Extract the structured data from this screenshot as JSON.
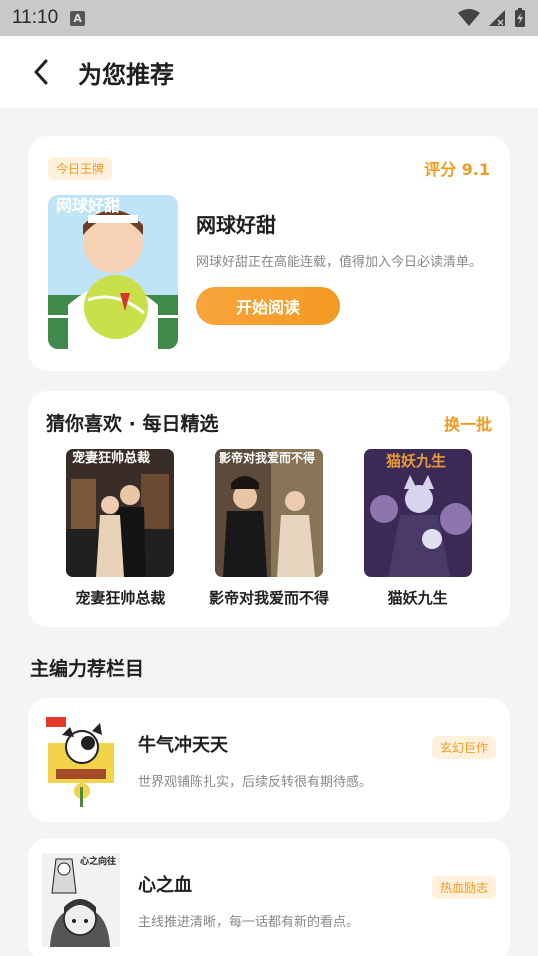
{
  "status": {
    "time": "11:10",
    "indicator": "A"
  },
  "header": {
    "title": "为您推荐"
  },
  "featured": {
    "tag": "今日王牌",
    "rating": "评分 9.1",
    "title": "网球好甜",
    "cover_text": "网球好甜",
    "description": "网球好甜正在高能连载，值得加入今日必读清单。",
    "read_button": "开始阅读"
  },
  "guess": {
    "title": "猜你喜欢 · 每日精选",
    "refresh": "换一批",
    "items": [
      {
        "title": "宠妻狂帅总裁",
        "cover_text": "宠妻狂帅总裁"
      },
      {
        "title": "影帝对我爱而不得",
        "cover_text": "影帝对我爱而不得"
      },
      {
        "title": "猫妖九生",
        "cover_text": "猫妖九生"
      }
    ]
  },
  "editor": {
    "title": "主编力荐栏目",
    "items": [
      {
        "title": "牛气冲天天",
        "desc": "世界观铺陈扎实，后续反转很有期待感。",
        "tag": "玄幻巨作"
      },
      {
        "title": "心之血",
        "desc": "主线推进清晰，每一话都有新的看点。",
        "tag": "热血励志",
        "cover_text": "心之向往"
      }
    ]
  },
  "colors": {
    "accent": "#f39a22",
    "tag_bg": "#fff1dc"
  }
}
